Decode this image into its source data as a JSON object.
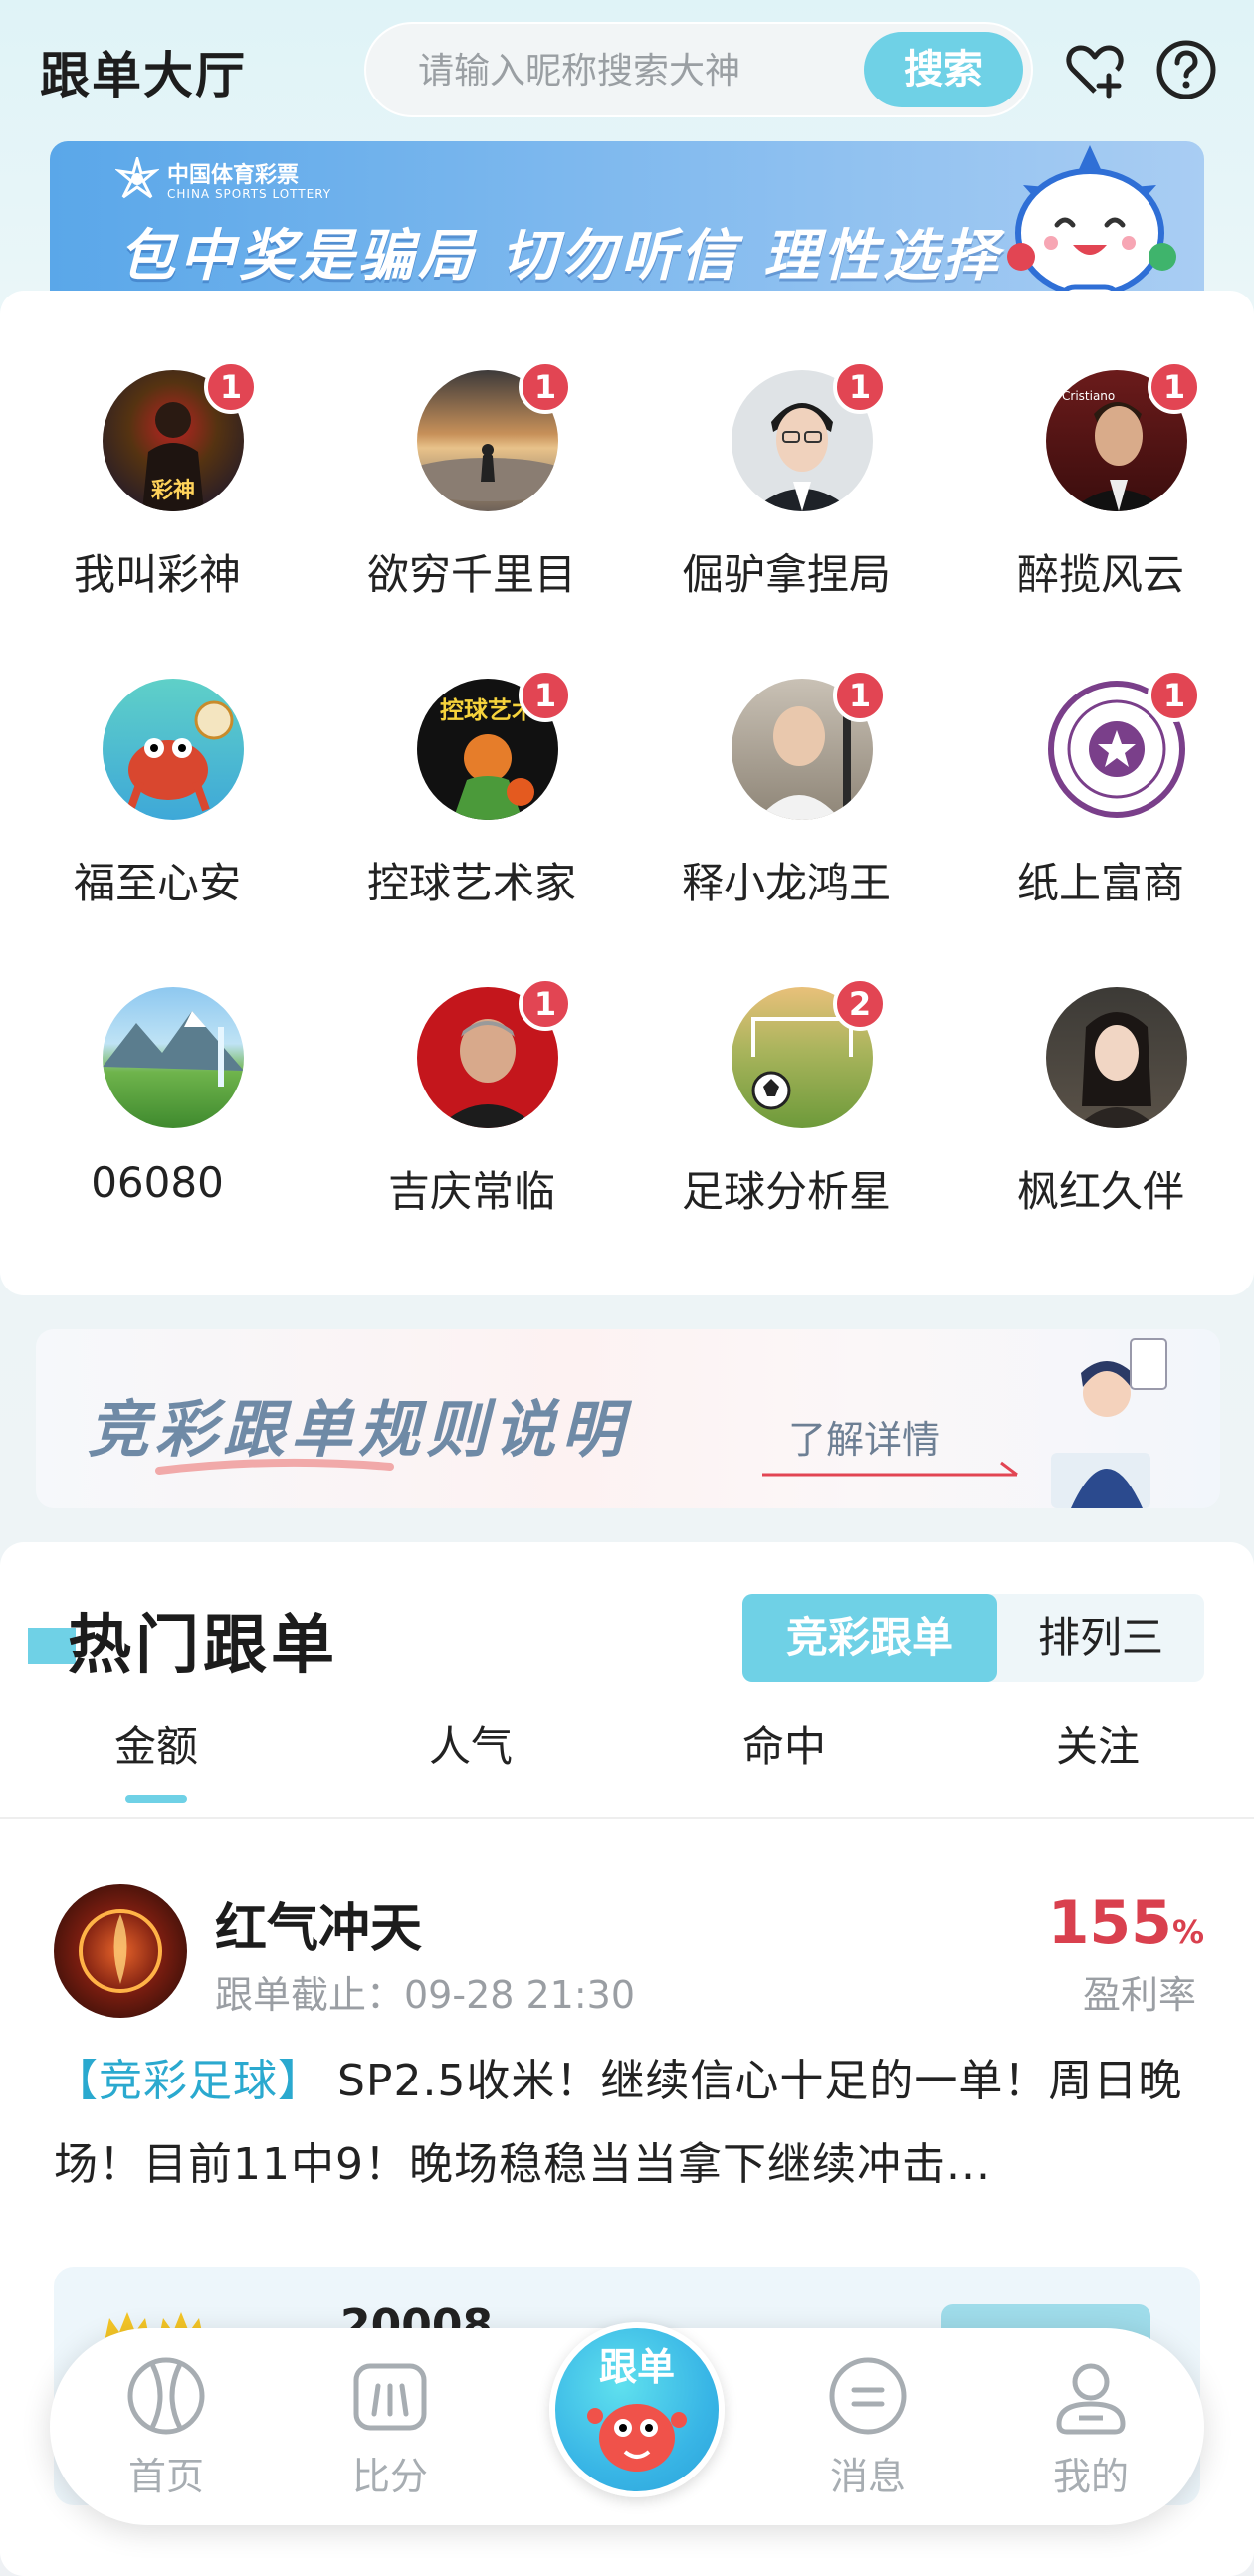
{
  "header": {
    "title": "跟单大厅",
    "search_placeholder": "请输入昵称搜索大神",
    "search_button": "搜索"
  },
  "banner": {
    "logo_cn": "中国体育彩票",
    "logo_en": "CHINA SPORTS LOTTERY",
    "slogan": "包中奖是骗局 切勿听信 理性选择"
  },
  "experts": [
    {
      "name": "我叫彩神",
      "badge": "1"
    },
    {
      "name": "欲穷千里目",
      "badge": "1"
    },
    {
      "name": "倔驴拿捏局",
      "badge": "1"
    },
    {
      "name": "醉揽风云",
      "badge": "1"
    },
    {
      "name": "福至心安",
      "badge": ""
    },
    {
      "name": "控球艺术家",
      "badge": "1"
    },
    {
      "name": "释小龙鸿王",
      "badge": "1"
    },
    {
      "name": "纸上富商",
      "badge": "1"
    },
    {
      "name": "06080",
      "badge": ""
    },
    {
      "name": "吉庆常临",
      "badge": "1"
    },
    {
      "name": "足球分析星",
      "badge": "2"
    },
    {
      "name": "枫红久伴",
      "badge": ""
    }
  ],
  "rules_banner": {
    "title": "竞彩跟单规则说明",
    "link": "了解详情"
  },
  "hot": {
    "title": "热门跟单",
    "segments": [
      "竞彩跟单",
      "排列三"
    ],
    "active_segment": "竞彩跟单",
    "sort_tabs": [
      "金额",
      "人气",
      "命中",
      "关注"
    ],
    "active_sort": "金额"
  },
  "post": {
    "username": "红气冲天",
    "deadline": "跟单截止：09-28 21:30",
    "rate_value": "155",
    "rate_unit": "%",
    "rate_label": "盈利率",
    "tag": "【竞彩足球】",
    "text": " SP2.5收米！继续信心十足的一单！周日晚场！目前11中9！晚场稳稳当当拿下继续冲击...",
    "amount": "20008"
  },
  "nav": {
    "items": [
      "首页",
      "比分",
      "跟单",
      "消息",
      "我的"
    ],
    "active": "跟单"
  },
  "colors": {
    "accent": "#6fd1e6",
    "badge_red": "#e24553",
    "rate_red": "#d9404e",
    "tag_blue": "#2aa9cf"
  }
}
